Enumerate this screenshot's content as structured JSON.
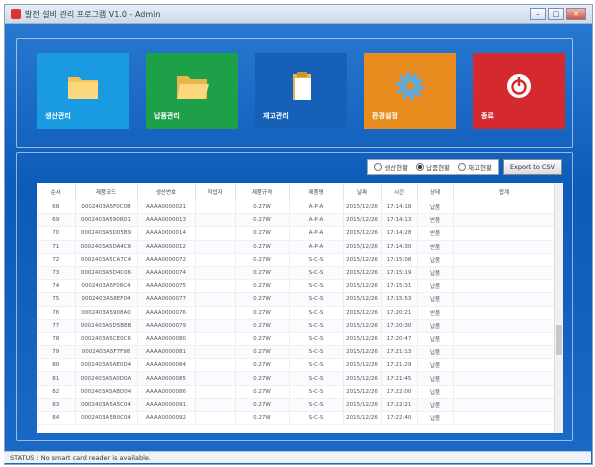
{
  "window": {
    "title": "발전 설비 관리 프로그램 V1.0 - Admin"
  },
  "tiles": [
    {
      "label": "생산관리",
      "icon": "folder-icon",
      "color": "#1a9ae0"
    },
    {
      "label": "납품관리",
      "icon": "open-folder-icon",
      "color": "#1ea048"
    },
    {
      "label": "재고관리",
      "icon": "clipboard-icon",
      "color": "#1660b8"
    },
    {
      "label": "환경설정",
      "icon": "gear-icon",
      "color": "#e98c1f"
    },
    {
      "label": "종료",
      "icon": "power-icon",
      "color": "#d42a2f"
    }
  ],
  "filters": {
    "options": [
      "생산현황",
      "납품현황",
      "재고현황"
    ],
    "selected": "납품현황",
    "export_label": "Export to CSV"
  },
  "table": {
    "columns": [
      "순서",
      "제품코드",
      "생산번호",
      "작업자",
      "제품규격",
      "제품명",
      "날짜",
      "시간",
      "상태",
      "합계"
    ],
    "rows": [
      [
        "68",
        "0002403A5F0C08",
        "AAAA0000021",
        "",
        "0.27W",
        "A-P-A",
        "2015/12/26",
        "17:14:18",
        "납품",
        ""
      ],
      [
        "69",
        "0002403A5908D1",
        "AAAA0000013",
        "",
        "0.27W",
        "A-P-A",
        "2015/12/26",
        "17:14:13",
        "반품",
        ""
      ],
      [
        "70",
        "0002403A5D05B9",
        "AAAA0000014",
        "",
        "0.27W",
        "A-P-A",
        "2015/12/26",
        "17:14:28",
        "반품",
        ""
      ],
      [
        "71",
        "0002403A5DA4C6",
        "AAAA0000012",
        "",
        "0.27W",
        "A-P-A",
        "2015/12/26",
        "17:14:30",
        "반품",
        ""
      ],
      [
        "72",
        "0002403A5CA7C4",
        "AAAA0000072",
        "",
        "0.27W",
        "S-C-S",
        "2015/12/26",
        "17:15:08",
        "납품",
        ""
      ],
      [
        "73",
        "0002403A5D4C06",
        "AAAA0000074",
        "",
        "0.27W",
        "S-C-S",
        "2015/12/26",
        "17:15:19",
        "납품",
        ""
      ],
      [
        "74",
        "0002403A5F06C4",
        "AAAA0000075",
        "",
        "0.27W",
        "S-C-S",
        "2015/12/26",
        "17:15:31",
        "납품",
        ""
      ],
      [
        "75",
        "0002403A58EF04",
        "AAAA0000077",
        "",
        "0.27W",
        "S-C-S",
        "2015/12/26",
        "17:15:53",
        "납품",
        ""
      ],
      [
        "76",
        "0002403A5908A0",
        "AAAA0000076",
        "",
        "0.27W",
        "S-C-S",
        "2015/12/26",
        "17:20:21",
        "반품",
        ""
      ],
      [
        "77",
        "0002403A5D5B8B",
        "AAAA0000079",
        "",
        "0.27W",
        "S-C-S",
        "2015/12/26",
        "17:20:30",
        "납품",
        ""
      ],
      [
        "78",
        "0002403A5CE0C6",
        "AAAA0000080",
        "",
        "0.27W",
        "S-C-S",
        "2015/12/26",
        "17:20:47",
        "납품",
        ""
      ],
      [
        "79",
        "0002403A5F7F98",
        "AAAA0000081",
        "",
        "0.27W",
        "S-C-S",
        "2015/12/26",
        "17:21:13",
        "납품",
        ""
      ],
      [
        "80",
        "0002403A5AE0D4",
        "AAAA0000084",
        "",
        "0.27W",
        "S-C-S",
        "2015/12/26",
        "17:21:29",
        "납품",
        ""
      ],
      [
        "81",
        "0002403A5A0D0A",
        "AAAA0000085",
        "",
        "0.27W",
        "S-C-S",
        "2015/12/26",
        "17:21:45",
        "납품",
        ""
      ],
      [
        "82",
        "0002403A5ABD04",
        "AAAA0000086",
        "",
        "0.27W",
        "S-C-S",
        "2015/12/26",
        "17:22:00",
        "납품",
        ""
      ],
      [
        "83",
        "0002403A5A5C04",
        "AAAA0000091",
        "",
        "0.27W",
        "S-C-S",
        "2015/12/26",
        "17:22:21",
        "납품",
        ""
      ],
      [
        "84",
        "0002403A5B0C04",
        "AAAA0000092",
        "",
        "0.27W",
        "S-C-S",
        "2015/12/26",
        "17:22:40",
        "납품",
        ""
      ]
    ]
  },
  "status": {
    "text": "STATUS :  No smart card reader is available."
  }
}
